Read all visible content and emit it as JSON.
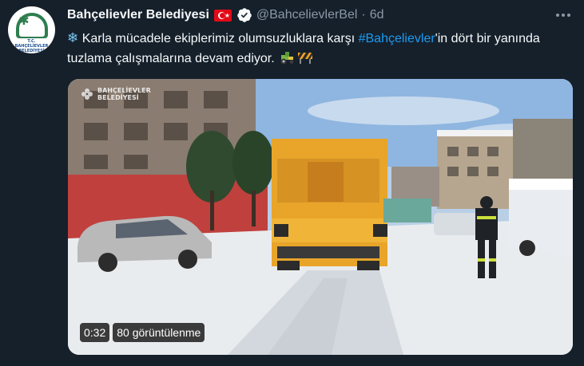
{
  "author": {
    "display_name": "Bahçelievler Belediyesi",
    "handle": "@BahcelievlerBel",
    "separator": "·",
    "time": "6d",
    "avatar_text_line1": "T.C.",
    "avatar_text_line2": "BAHÇELİEVLER",
    "avatar_text_line3": "BELEDİYESİ"
  },
  "tweet": {
    "text_before": " Karla mücadele ekiplerimiz olumsuzluklara karşı ",
    "hashtag": "#Bahçelievler",
    "text_after": "'in dört bir yanında tuzlama çalışmalarına devam ediyor. ",
    "leading_icon": "snowflake-icon",
    "trailing_icons": [
      "tractor-icon",
      "construction-barrier-icon"
    ]
  },
  "media": {
    "watermark_line1": "BAHÇELİEVLER",
    "watermark_line2": "BELEDİYESİ",
    "duration": "0:32",
    "views": "80 görüntülenme"
  },
  "colors": {
    "background": "#15202b",
    "text": "#f7f9f9",
    "secondary_text": "#8b98a5",
    "accent": "#1d9bf0",
    "verified_badge": "#f7f9f9"
  }
}
